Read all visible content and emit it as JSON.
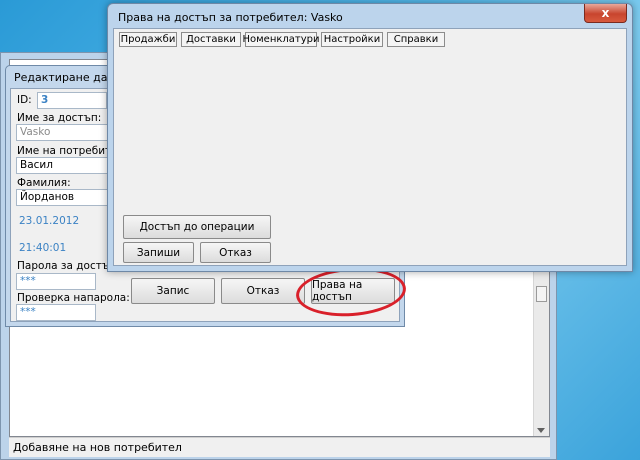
{
  "app": {
    "status_text": "Добавяне на нов потребител"
  },
  "edit_dialog": {
    "title": "Редактиране данни н",
    "id_label": "ID:",
    "id_value": "3",
    "username_label": "Име за достъп:",
    "username_value": "Vasko",
    "name_label": "Име на потребителя:",
    "name_value": "Васил",
    "surname_label": "Фамилия:",
    "surname_value": "Йорданов",
    "date_value": "23.01.2012",
    "time_value": "21:40:01",
    "password_label": "Парола за достъп:",
    "password_value": "***",
    "confirm_label": "Проверка напарола:",
    "confirm_value": "***",
    "save_button": "Запис",
    "cancel_button": "Отказ",
    "rights_button": "Права на достъп",
    "accent_color": "#3b82c4",
    "highlight_color": "#d9202a"
  },
  "rights_window": {
    "title": "Права на достъп за потребител: Vasko",
    "close_glyph": "x",
    "tabs": [
      "Продажби",
      "Доставки",
      "Номенклатури",
      "Настройки",
      "Справки"
    ],
    "operations_button": "Достъп до операции",
    "save_button": "Запиши",
    "cancel_button": "Отказ"
  }
}
